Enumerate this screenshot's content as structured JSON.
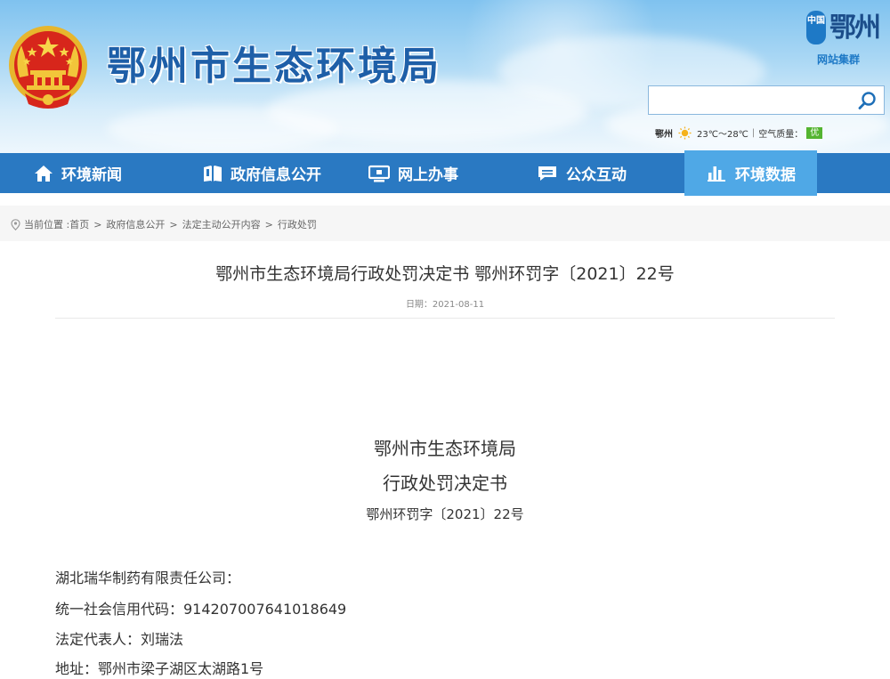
{
  "header": {
    "site_title": "鄂州市生态环境局",
    "portal_seal": "中国",
    "portal_char": "鄂州",
    "portal_sub": "网站集群",
    "search": {
      "placeholder": ""
    },
    "weather": {
      "city": "鄂州",
      "icon": "sun-icon",
      "temp": "23℃～28℃",
      "sep": "|",
      "aq_label": "空气质量：",
      "aq_value": "优",
      "aq_color": "#54b431"
    }
  },
  "nav": {
    "color": "#2a79c2",
    "active_color": "#4fa8e6",
    "items": [
      {
        "label": "环境新闻",
        "icon": "home-icon"
      },
      {
        "label": "政府信息公开",
        "icon": "book-icon"
      },
      {
        "label": "网上办事",
        "icon": "monitor-icon"
      },
      {
        "label": "公众互动",
        "icon": "chat-icon"
      },
      {
        "label": "环境数据",
        "icon": "bar-chart-icon",
        "active": true
      }
    ]
  },
  "breadcrumb": {
    "prefix": "当前位置 :",
    "items": [
      "首页",
      "政府信息公开",
      "法定主动公开内容",
      "行政处罚"
    ],
    "separator": ">"
  },
  "article": {
    "title": "鄂州市生态环境局行政处罚决定书 鄂州环罚字〔2021〕22号",
    "date": "日期：2021-08-11",
    "doc_heading_1": "鄂州市生态环境局",
    "doc_heading_2": "行政处罚决定书",
    "doc_number": "鄂州环罚字〔2021〕22号",
    "paragraphs": [
      "湖北瑞华制药有限责任公司：",
      "统一社会信用代码：914207007641018649",
      "法定代表人：刘瑞法",
      "地址：鄂州市梁子湖区太湖路1号"
    ]
  }
}
